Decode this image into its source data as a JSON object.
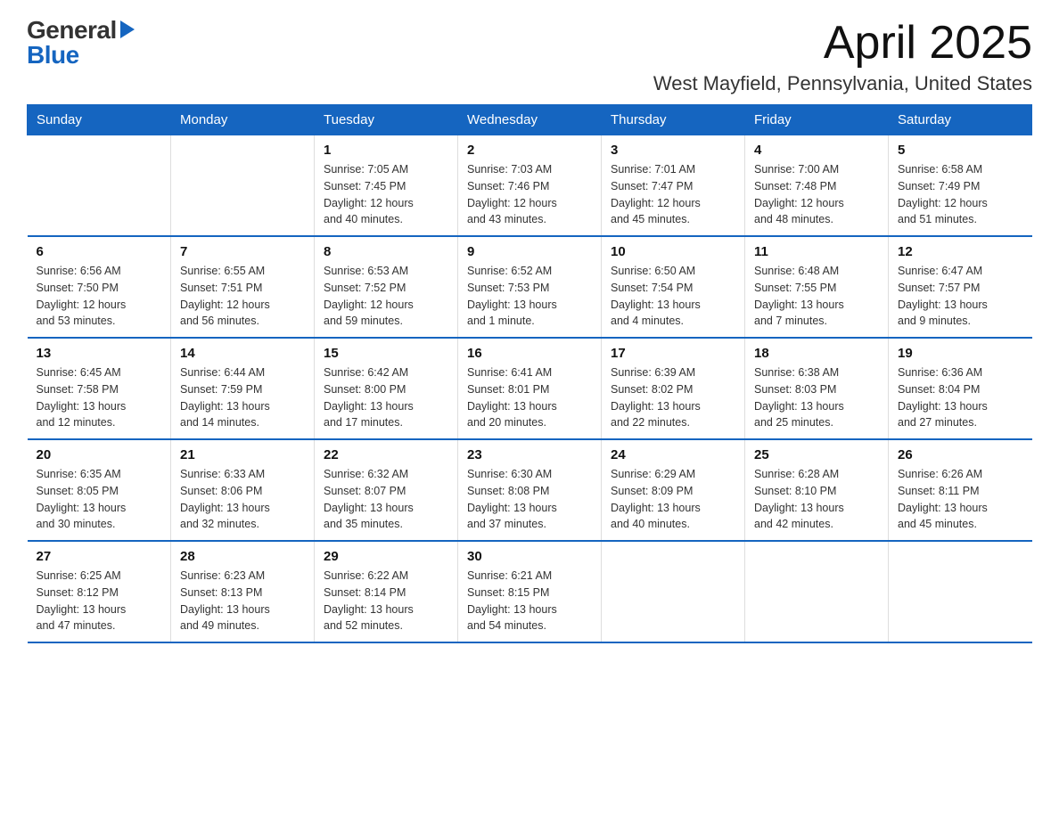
{
  "logo": {
    "general": "General",
    "blue": "Blue"
  },
  "title": "April 2025",
  "location": "West Mayfield, Pennsylvania, United States",
  "days_of_week": [
    "Sunday",
    "Monday",
    "Tuesday",
    "Wednesday",
    "Thursday",
    "Friday",
    "Saturday"
  ],
  "weeks": [
    [
      {
        "day": "",
        "info": ""
      },
      {
        "day": "",
        "info": ""
      },
      {
        "day": "1",
        "info": "Sunrise: 7:05 AM\nSunset: 7:45 PM\nDaylight: 12 hours\nand 40 minutes."
      },
      {
        "day": "2",
        "info": "Sunrise: 7:03 AM\nSunset: 7:46 PM\nDaylight: 12 hours\nand 43 minutes."
      },
      {
        "day": "3",
        "info": "Sunrise: 7:01 AM\nSunset: 7:47 PM\nDaylight: 12 hours\nand 45 minutes."
      },
      {
        "day": "4",
        "info": "Sunrise: 7:00 AM\nSunset: 7:48 PM\nDaylight: 12 hours\nand 48 minutes."
      },
      {
        "day": "5",
        "info": "Sunrise: 6:58 AM\nSunset: 7:49 PM\nDaylight: 12 hours\nand 51 minutes."
      }
    ],
    [
      {
        "day": "6",
        "info": "Sunrise: 6:56 AM\nSunset: 7:50 PM\nDaylight: 12 hours\nand 53 minutes."
      },
      {
        "day": "7",
        "info": "Sunrise: 6:55 AM\nSunset: 7:51 PM\nDaylight: 12 hours\nand 56 minutes."
      },
      {
        "day": "8",
        "info": "Sunrise: 6:53 AM\nSunset: 7:52 PM\nDaylight: 12 hours\nand 59 minutes."
      },
      {
        "day": "9",
        "info": "Sunrise: 6:52 AM\nSunset: 7:53 PM\nDaylight: 13 hours\nand 1 minute."
      },
      {
        "day": "10",
        "info": "Sunrise: 6:50 AM\nSunset: 7:54 PM\nDaylight: 13 hours\nand 4 minutes."
      },
      {
        "day": "11",
        "info": "Sunrise: 6:48 AM\nSunset: 7:55 PM\nDaylight: 13 hours\nand 7 minutes."
      },
      {
        "day": "12",
        "info": "Sunrise: 6:47 AM\nSunset: 7:57 PM\nDaylight: 13 hours\nand 9 minutes."
      }
    ],
    [
      {
        "day": "13",
        "info": "Sunrise: 6:45 AM\nSunset: 7:58 PM\nDaylight: 13 hours\nand 12 minutes."
      },
      {
        "day": "14",
        "info": "Sunrise: 6:44 AM\nSunset: 7:59 PM\nDaylight: 13 hours\nand 14 minutes."
      },
      {
        "day": "15",
        "info": "Sunrise: 6:42 AM\nSunset: 8:00 PM\nDaylight: 13 hours\nand 17 minutes."
      },
      {
        "day": "16",
        "info": "Sunrise: 6:41 AM\nSunset: 8:01 PM\nDaylight: 13 hours\nand 20 minutes."
      },
      {
        "day": "17",
        "info": "Sunrise: 6:39 AM\nSunset: 8:02 PM\nDaylight: 13 hours\nand 22 minutes."
      },
      {
        "day": "18",
        "info": "Sunrise: 6:38 AM\nSunset: 8:03 PM\nDaylight: 13 hours\nand 25 minutes."
      },
      {
        "day": "19",
        "info": "Sunrise: 6:36 AM\nSunset: 8:04 PM\nDaylight: 13 hours\nand 27 minutes."
      }
    ],
    [
      {
        "day": "20",
        "info": "Sunrise: 6:35 AM\nSunset: 8:05 PM\nDaylight: 13 hours\nand 30 minutes."
      },
      {
        "day": "21",
        "info": "Sunrise: 6:33 AM\nSunset: 8:06 PM\nDaylight: 13 hours\nand 32 minutes."
      },
      {
        "day": "22",
        "info": "Sunrise: 6:32 AM\nSunset: 8:07 PM\nDaylight: 13 hours\nand 35 minutes."
      },
      {
        "day": "23",
        "info": "Sunrise: 6:30 AM\nSunset: 8:08 PM\nDaylight: 13 hours\nand 37 minutes."
      },
      {
        "day": "24",
        "info": "Sunrise: 6:29 AM\nSunset: 8:09 PM\nDaylight: 13 hours\nand 40 minutes."
      },
      {
        "day": "25",
        "info": "Sunrise: 6:28 AM\nSunset: 8:10 PM\nDaylight: 13 hours\nand 42 minutes."
      },
      {
        "day": "26",
        "info": "Sunrise: 6:26 AM\nSunset: 8:11 PM\nDaylight: 13 hours\nand 45 minutes."
      }
    ],
    [
      {
        "day": "27",
        "info": "Sunrise: 6:25 AM\nSunset: 8:12 PM\nDaylight: 13 hours\nand 47 minutes."
      },
      {
        "day": "28",
        "info": "Sunrise: 6:23 AM\nSunset: 8:13 PM\nDaylight: 13 hours\nand 49 minutes."
      },
      {
        "day": "29",
        "info": "Sunrise: 6:22 AM\nSunset: 8:14 PM\nDaylight: 13 hours\nand 52 minutes."
      },
      {
        "day": "30",
        "info": "Sunrise: 6:21 AM\nSunset: 8:15 PM\nDaylight: 13 hours\nand 54 minutes."
      },
      {
        "day": "",
        "info": ""
      },
      {
        "day": "",
        "info": ""
      },
      {
        "day": "",
        "info": ""
      }
    ]
  ]
}
